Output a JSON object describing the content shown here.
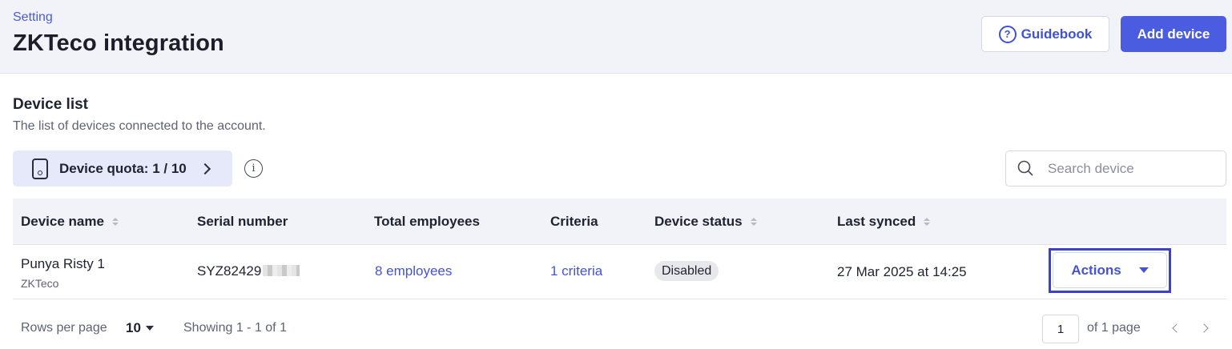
{
  "breadcrumb": "Setting",
  "title": "ZKTeco integration",
  "header": {
    "guidebook_label": "Guidebook",
    "add_device_label": "Add device"
  },
  "section": {
    "title": "Device list",
    "subtitle": "The list of devices connected to the account."
  },
  "quota": {
    "label": "Device quota: 1 / 10"
  },
  "search": {
    "placeholder": "Search device"
  },
  "table": {
    "columns": [
      "Device name",
      "Serial number",
      "Total employees",
      "Criteria",
      "Device status",
      "Last synced"
    ],
    "rows": [
      {
        "device_name": "Punya Risty 1",
        "device_type": "ZKTeco",
        "serial": "SYZ82429",
        "employees": "8 employees",
        "criteria": "1 criteria",
        "status": "Disabled",
        "last_synced": "27 Mar 2025 at 14:25",
        "actions_label": "Actions"
      }
    ]
  },
  "footer": {
    "rows_per_page_label": "Rows per page",
    "rows_per_page_value": "10",
    "showing": "Showing 1 - 1 of 1",
    "page_value": "1",
    "of_pages": "of 1 page"
  },
  "colors": {
    "accent": "#4a5ce0",
    "link": "#4453d4",
    "highlight_frame": "#3a3fd6"
  }
}
